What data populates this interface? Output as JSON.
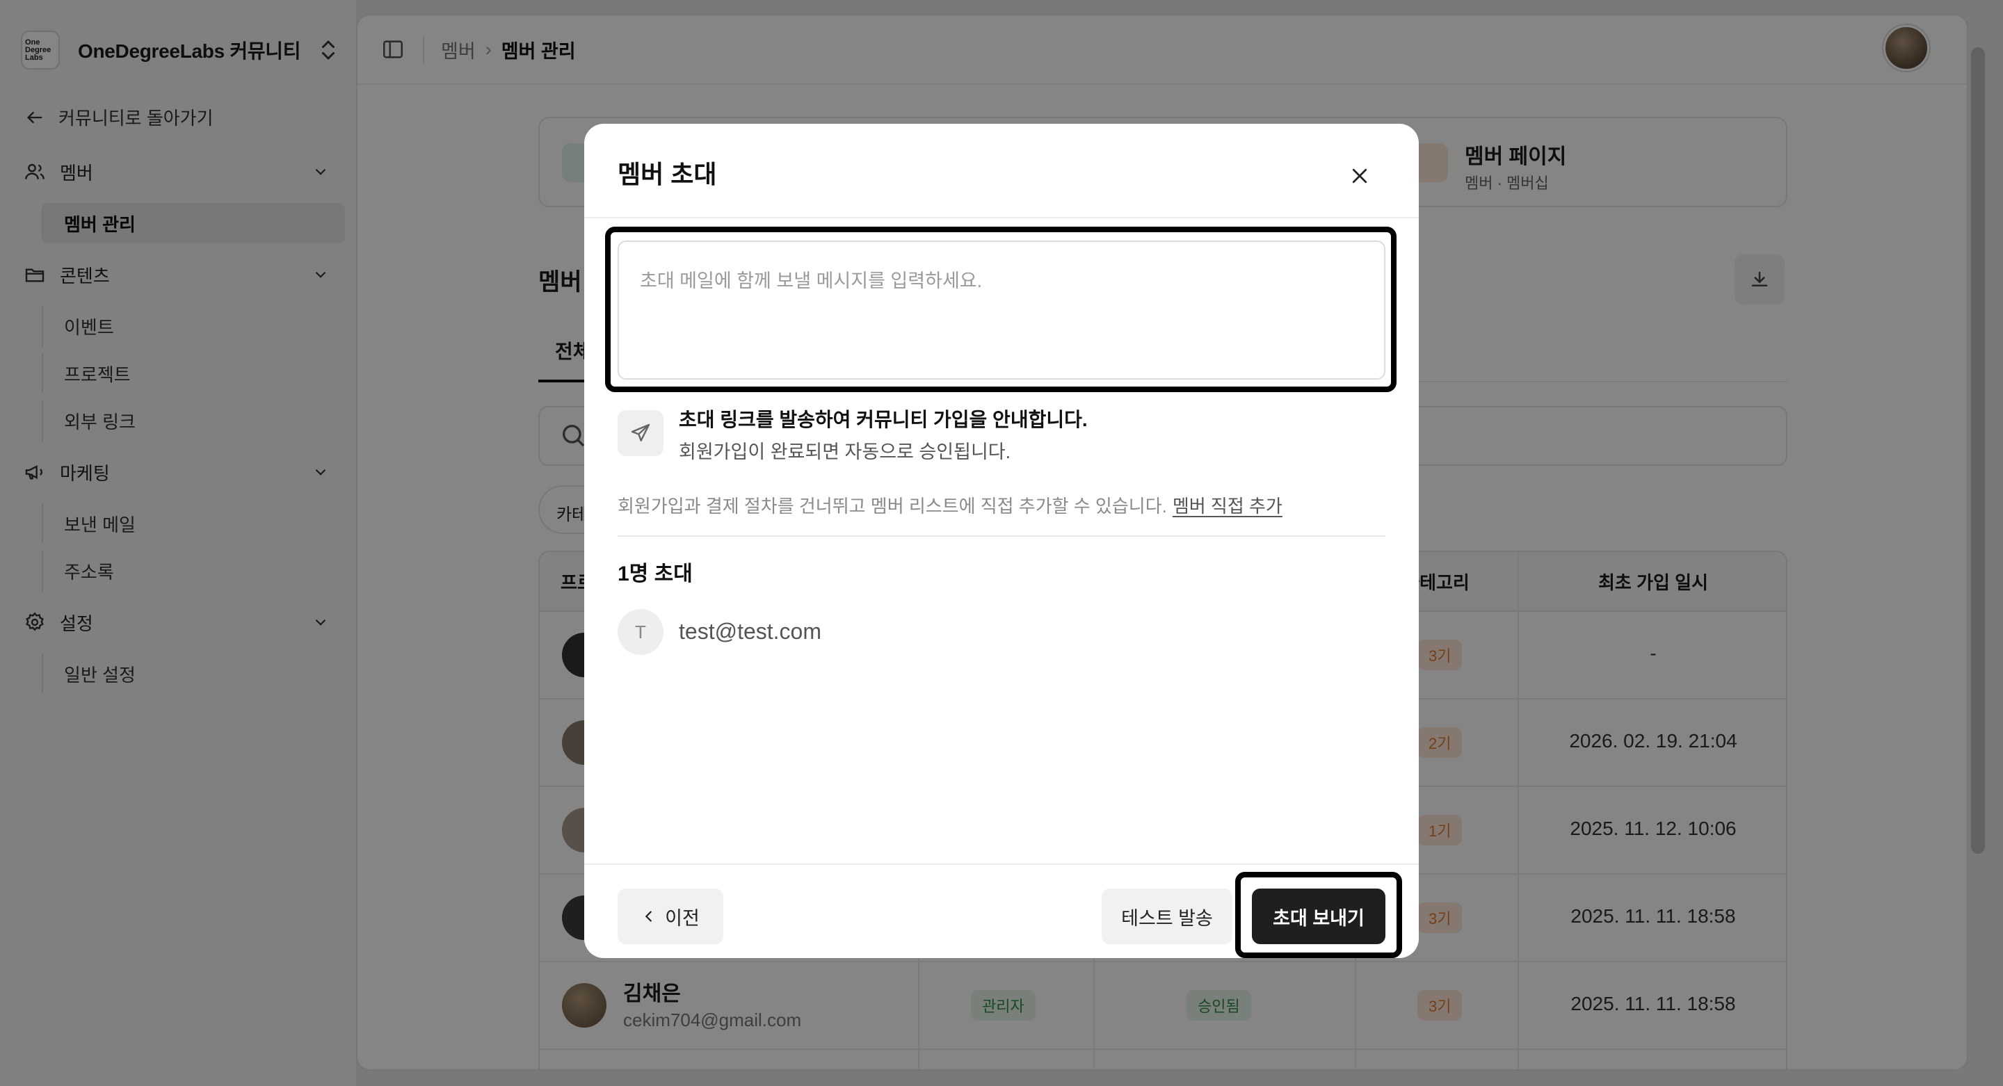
{
  "workspace": {
    "logo_text": "One Degree Labs",
    "name": "OneDegreeLabs 커뮤니티"
  },
  "sidebar": {
    "back_label": "커뮤니티로 돌아가기",
    "groups": [
      {
        "label": "멤버",
        "items": [
          "멤버 관리"
        ]
      },
      {
        "label": "콘텐츠",
        "items": [
          "이벤트",
          "프로젝트",
          "외부 링크"
        ]
      },
      {
        "label": "마케팅",
        "items": [
          "보낸 메일",
          "주소록"
        ]
      },
      {
        "label": "설정",
        "items": [
          "일반 설정"
        ]
      }
    ]
  },
  "breadcrumb": [
    "멤버",
    "멤버 관리"
  ],
  "background": {
    "card": {
      "title": "멤버 페이지",
      "subtitle": "멤버 · 멤버십"
    },
    "section_title": "멤버",
    "tab": "전체",
    "filter": "카테",
    "table": {
      "headers": {
        "profile": "프로",
        "category": "카테고리",
        "joined": "최초 가입 일시"
      },
      "rows": [
        {
          "gen": "3기",
          "date": "-"
        },
        {
          "gen": "2기",
          "date": "2026. 02. 19. 21:04"
        },
        {
          "gen": "1기",
          "date": "2025. 11. 12. 10:06"
        },
        {
          "gen": "3기",
          "date": "2025. 11. 11. 18:58"
        },
        {
          "name": "김채은",
          "email": "cekim704@gmail.com",
          "role": "관리자",
          "status": "승인됨",
          "gen": "3기",
          "date": "2025. 11. 11. 18:58"
        }
      ]
    }
  },
  "modal": {
    "title": "멤버 초대",
    "message_placeholder": "초대 메일에 함께 보낼 메시지를 입력하세요.",
    "message_value": "",
    "info_title": "초대 링크를 발송하여 커뮤니티 가입을 안내합니다.",
    "info_sub": "회원가입이 완료되면 자동으로 승인됩니다.",
    "direct_text": "회원가입과 결제 절차를 건너뛰고 멤버 리스트에 직접 추가할 수 있습니다.",
    "direct_link": "멤버 직접 추가",
    "invite_count": "1명 초대",
    "invitees": [
      {
        "initial": "T",
        "email": "test@test.com"
      }
    ],
    "buttons": {
      "prev": "이전",
      "test": "테스트 발송",
      "send": "초대 보내기"
    }
  },
  "colors": {
    "accent_dark": "#1f1f1f",
    "overlay": "rgba(0,0,0,0.48)",
    "gen_badge": "#e07a2c",
    "ok_badge": "#2f8a45"
  }
}
